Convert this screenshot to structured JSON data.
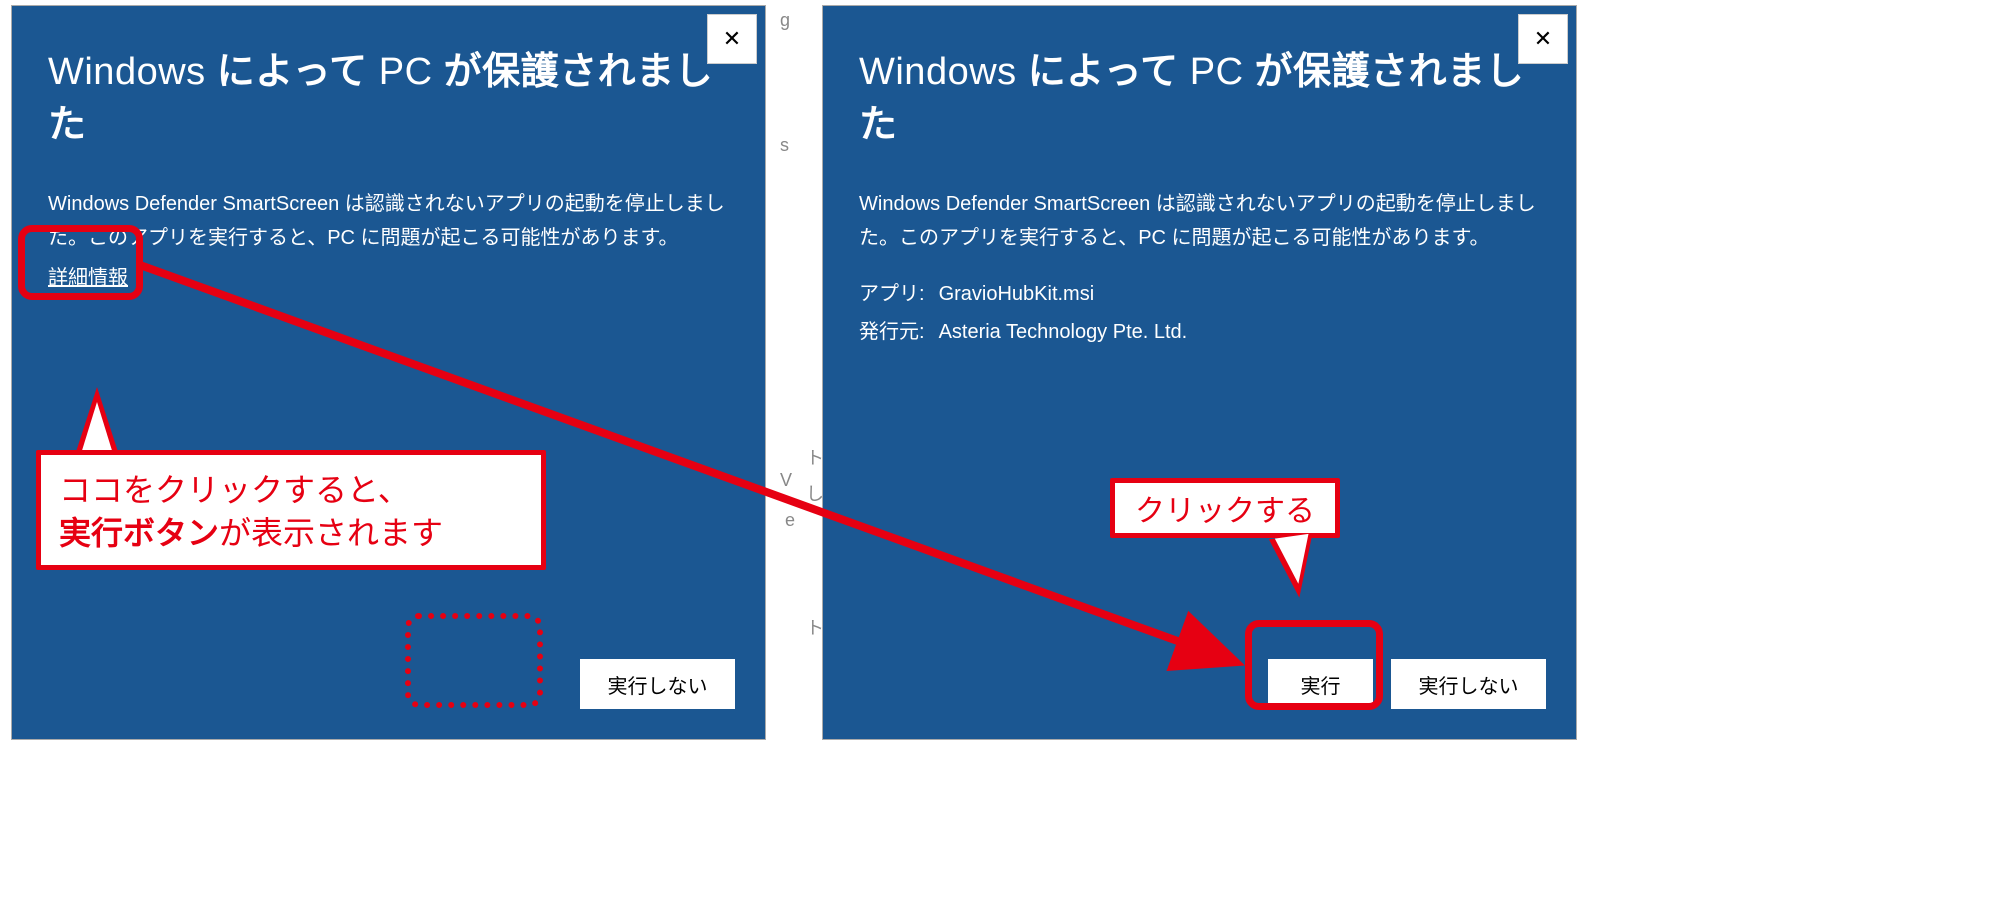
{
  "dialog_left": {
    "title_prefix": "Windows ",
    "title_mid1": "によって ",
    "title_pc": "PC ",
    "title_mid2": "が保護されました",
    "body": "Windows Defender SmartScreen は認識されないアプリの起動を停止しました。このアプリを実行すると、PC に問題が起こる可能性があります。",
    "more_link": "詳細情報",
    "btn_dont_run": "実行しない",
    "close_icon": "✕"
  },
  "dialog_right": {
    "title_prefix": "Windows ",
    "title_mid1": "によって ",
    "title_pc": "PC ",
    "title_mid2": "が保護されました",
    "body": "Windows Defender SmartScreen は認識されないアプリの起動を停止しました。このアプリを実行すると、PC に問題が起こる可能性があります。",
    "app_label": "アプリ:",
    "app_value": "GravioHubKit.msi",
    "publisher_label": "発行元:",
    "publisher_value": "Asteria Technology Pte. Ltd.",
    "btn_run": "実行",
    "btn_dont_run": "実行しない",
    "close_icon": "✕"
  },
  "annotations": {
    "callout1_line1": "ココをクリックすると、",
    "callout1_strong": "実行ボタン",
    "callout1_line2_rest": "が表示されます",
    "callout2": "クリックする",
    "highlight_color": "#e60012"
  }
}
